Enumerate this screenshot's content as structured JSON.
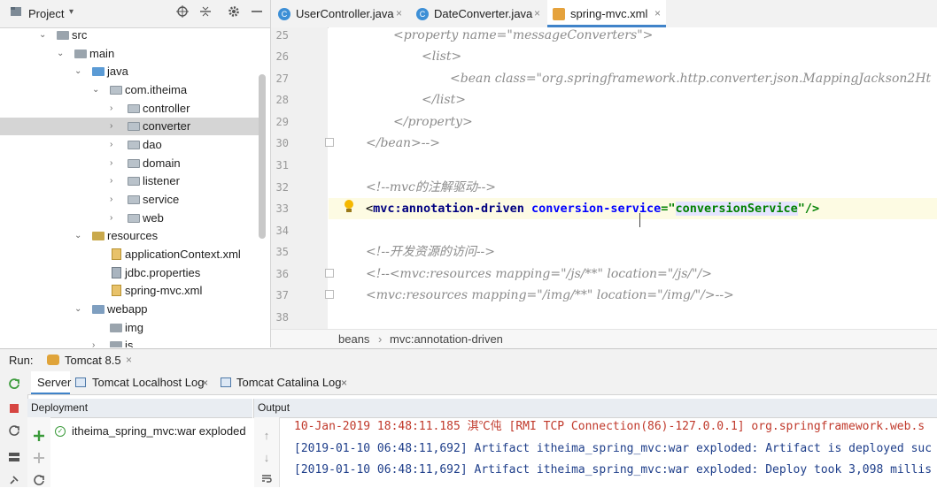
{
  "project_panel": {
    "title": "Project",
    "dropdown_glyph": "▾",
    "header_icons": [
      "crosshair-icon",
      "collapse-icon",
      "gear-icon",
      "minimize-icon"
    ],
    "tree": [
      {
        "label": "src",
        "expanded": true
      },
      {
        "label": "main",
        "expanded": true
      },
      {
        "label": "java",
        "expanded": true
      },
      {
        "label": "com.itheima",
        "expanded": true
      },
      {
        "label": "controller",
        "expanded": false
      },
      {
        "label": "converter",
        "expanded": false,
        "selected": true
      },
      {
        "label": "dao",
        "expanded": false
      },
      {
        "label": "domain",
        "expanded": false
      },
      {
        "label": "listener",
        "expanded": false
      },
      {
        "label": "service",
        "expanded": false
      },
      {
        "label": "web",
        "expanded": false
      },
      {
        "label": "resources",
        "expanded": true
      },
      {
        "label": "applicationContext.xml"
      },
      {
        "label": "jdbc.properties"
      },
      {
        "label": "spring-mvc.xml"
      },
      {
        "label": "webapp",
        "expanded": true
      },
      {
        "label": "img"
      },
      {
        "label": "js"
      }
    ]
  },
  "editor_tabs": [
    {
      "label": "UserController.java",
      "type": "class",
      "active": false
    },
    {
      "label": "DateConverter.java",
      "type": "class",
      "active": false
    },
    {
      "label": "spring-mvc.xml",
      "type": "xml",
      "active": true
    }
  ],
  "close_glyph": "×",
  "editor": {
    "line_numbers": [
      "25",
      "26",
      "27",
      "28",
      "29",
      "30",
      "31",
      "32",
      "33",
      "34",
      "35",
      "36",
      "37",
      "38"
    ],
    "lines": [
      "<property name=\"messageConverters\">",
      "<list>",
      "<bean class=\"org.springframework.http.converter.json.MappingJackson2Ht",
      "</list>",
      "</property>",
      "</bean>-->",
      "",
      "<!--mvc的注解驱动-->",
      "",
      "",
      "<!--开发资源的访问-->",
      "<!--<mvc:resources mapping=\"/js/**\" location=\"/js/\"/>",
      "<mvc:resources mapping=\"/img/**\" location=\"/img/\"/>-->",
      ""
    ],
    "current_line": {
      "open": "<",
      "tag": "mvc:annotation-driven",
      "attr": "conversion-service",
      "eq": "=\"",
      "value": "conversionService",
      "close": "\"/>"
    }
  },
  "breadcrumb": [
    "beans",
    "›",
    "mvc:annotation-driven"
  ],
  "run_bar": {
    "label": "Run:",
    "config": "Tomcat 8.5"
  },
  "run_tabs": [
    {
      "label": "Server",
      "active": true
    },
    {
      "label": "Tomcat Localhost Log",
      "active": false
    },
    {
      "label": "Tomcat Catalina Log",
      "active": false
    }
  ],
  "deployment": {
    "header": "Deployment",
    "item": "itheima_spring_mvc:war exploded"
  },
  "output": {
    "header": "Output",
    "lines": [
      "10-Jan-2019 18:48:11.185 淇℃伅 [RMI TCP Connection(86)-127.0.0.1] org.springframework.web.s",
      "[2019-01-10 06:48:11,692] Artifact itheima_spring_mvc:war exploded: Artifact is deployed suc",
      "[2019-01-10 06:48:11,692] Artifact itheima_spring_mvc:war exploded: Deploy took 3,098 millis"
    ]
  },
  "colors": {
    "accent": "#4083c9",
    "xml_tag": "#000080",
    "xml_attr": "#0000ff",
    "xml_value": "#008000",
    "comment": "#8c8c8c",
    "log_red": "#c0392b",
    "log_blue": "#1e3e8a"
  }
}
